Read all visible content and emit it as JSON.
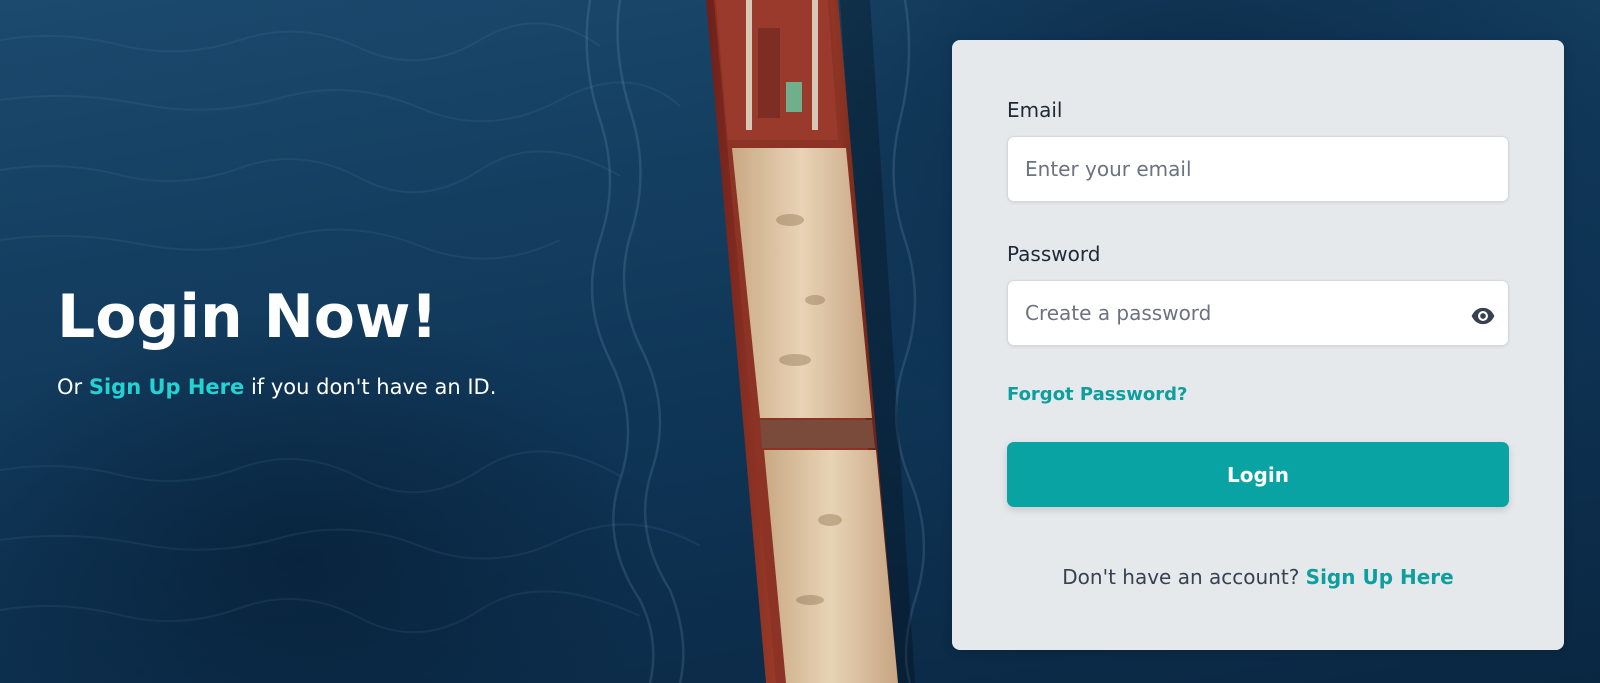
{
  "hero": {
    "title": "Login Now!",
    "subtitle_prefix": "Or ",
    "subtitle_link": "Sign Up Here",
    "subtitle_suffix": " if you don't have an ID."
  },
  "form": {
    "email_label": "Email",
    "email_placeholder": "Enter your email",
    "email_value": "",
    "password_label": "Password",
    "password_placeholder": "Create a password",
    "password_value": "",
    "password_toggle_icon": "eye-icon",
    "forgot_password": "Forgot Password?",
    "login_button": "Login",
    "signup_prompt": "Don't have an account? ",
    "signup_link": "Sign Up Here"
  },
  "colors": {
    "accent": "#0aa3a3",
    "hero_link": "#23d3d3",
    "card_background": "#e6e9ec"
  }
}
